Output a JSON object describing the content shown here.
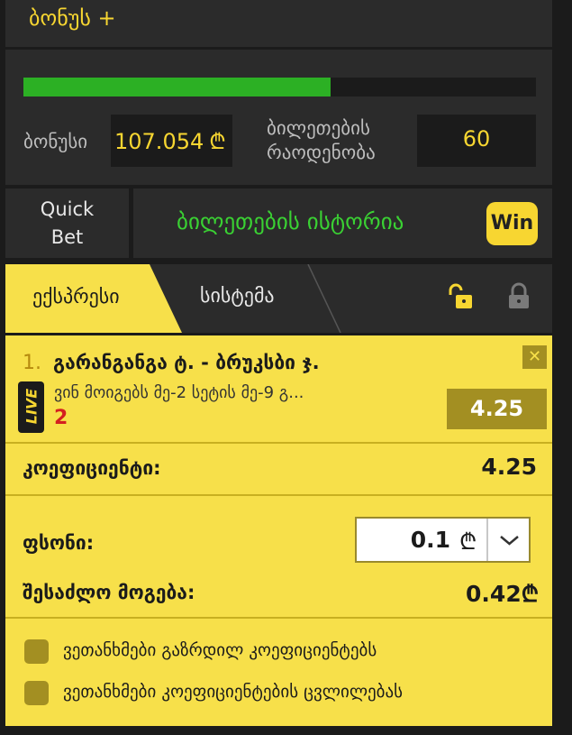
{
  "header": {
    "title": "ბონუს +"
  },
  "bonus": {
    "progress": 0.6,
    "label": "ბონუსი",
    "value": "107.054",
    "currency": "₾",
    "tickets_label_1": "ბილეთების",
    "tickets_label_2": "რაოდენობა",
    "tickets_value": "60"
  },
  "nav": {
    "quickbet_1": "Quick",
    "quickbet_2": "Bet",
    "history": "ბილეთების ისტორია",
    "win_logo": "Win"
  },
  "tabs": {
    "express": "ექსპრესი",
    "system": "სისტემა"
  },
  "slip": {
    "event_number": "1.",
    "event_title": "გარანგანგა ტ. - ბრუკსბი ჯ.",
    "live_badge": "LIVE",
    "event_sub": "ვინ მოიგებს მე-2 სეტის მე-9 გ...",
    "selection": "2",
    "odd": "4.25",
    "coef_label": "კოეფიციენტი:",
    "coef_value": "4.25",
    "stake_label": "ფსონი:",
    "stake_value": "0.1",
    "stake_currency": "₾",
    "possible_win_label": "შესაძლო მოგება:",
    "possible_win_value": "0.42₾",
    "agree_increase": "ვეთანხმები გაზრდილ კოეფიციენტებს",
    "agree_change": "ვეთანხმები კოეფიციენტების ცვლილებას"
  },
  "colors": {
    "accent_yellow": "#f7d631",
    "progress_green": "#2cb024",
    "history_green": "#3ad133",
    "live_red": "#d42020"
  }
}
